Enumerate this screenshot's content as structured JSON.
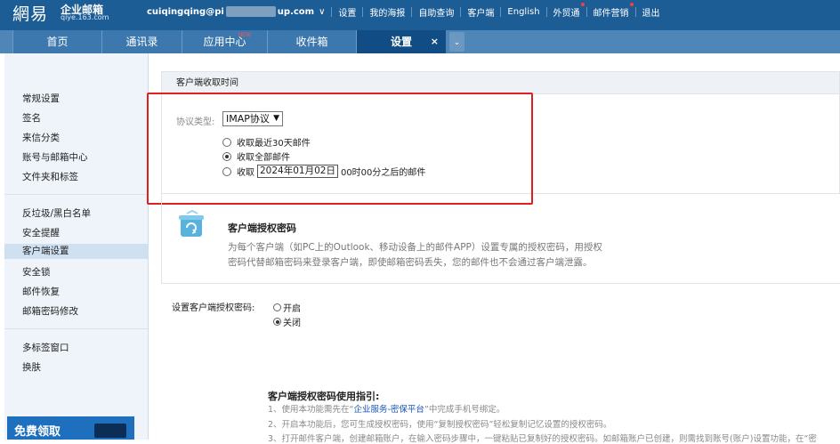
{
  "header": {
    "logo_cn": "網易",
    "logo_brand": "企业邮箱",
    "logo_domain": "qiye.163.com",
    "email_prefix": "cuiqingqing@pi",
    "email_suffix": "up.com",
    "dropdown_glyph": "∨",
    "nav": [
      "设置",
      "我的海报",
      "自助查询",
      "客户端",
      "English",
      "外贸通",
      "邮件营销",
      "退出"
    ],
    "brand_color": "#1d5d96"
  },
  "tabs": {
    "items": [
      "首页",
      "通讯录",
      "应用中心",
      "收件箱",
      "设置"
    ],
    "new_badge": "NEW",
    "close_glyph": "×",
    "more_glyph": "⌄",
    "active": "设置"
  },
  "sidebar": {
    "group1": [
      "常规设置",
      "签名",
      "来信分类",
      "账号与邮箱中心",
      "文件夹和标签"
    ],
    "group2": [
      "反垃圾/黑白名单",
      "安全提醒",
      "客户端设置",
      "安全锁",
      "邮件恢复",
      "邮箱密码修改"
    ],
    "group3": [
      "多标签窗口",
      "换肤"
    ],
    "active": "客户端设置",
    "promo_label": "免费领取"
  },
  "client_receive": {
    "section_title": "客户端收取时间",
    "protocol_label": "协议类型:",
    "protocol_value": "IMAP协议",
    "options": [
      "收取最近30天邮件",
      "收取全部邮件",
      "收取"
    ],
    "option_suffix": "00时00分之后的邮件",
    "selected_option": "收取全部邮件",
    "date_value": "2024年01月02日",
    "highlight_color": "#e02020"
  },
  "auth_code": {
    "icon": "recycle-box-icon",
    "title": "客户端授权密码",
    "desc_line1": "为每个客户端（如PC上的Outlook、移动设备上的邮件APP）设置专属的授权密码，用授权",
    "desc_line2": "密码代替邮箱密码来登录客户端，即使邮箱密码丢失，您的邮件也不会通过客户端泄露。",
    "setting_label": "设置客户端授权密码:",
    "on_label": "开启",
    "off_label": "关闭",
    "selected": "关闭"
  },
  "guide": {
    "title": "客户端授权密码使用指引:",
    "line1_pre": "1、使用本功能需先在“",
    "line1_link": "企业服务-密保平台",
    "line1_post": "”中完成手机号绑定。",
    "line2": "2、开启本功能后，您可生成授权密码，使用“复制授权密码”轻松复制记忆设置的授权密码。",
    "line3": "3、打开邮件客户端，创建邮箱账户，在输入密码步骤中，一键粘贴已复制好的授权密码。如邮箱账户已创建，则需找到账号(账户)设置功能，在“密"
  }
}
